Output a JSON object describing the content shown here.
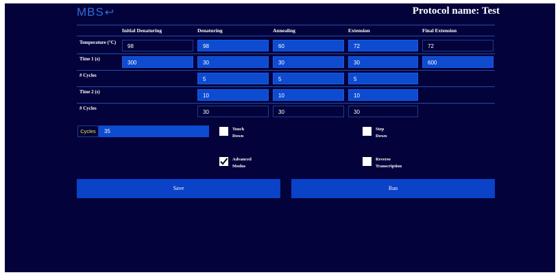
{
  "logo": {
    "text": "MBS",
    "arrow": "↩"
  },
  "header": {
    "protocol_title": "Protocol name: Test"
  },
  "columns": [
    "Initial Denaturing",
    "Denaturing",
    "Annealing",
    "Extension",
    "Final Extension"
  ],
  "rows": [
    {
      "label": "Temperature (°C)",
      "values": [
        "98",
        "98",
        "60",
        "72",
        "72"
      ]
    },
    {
      "label": "Time 1 (s)",
      "values": [
        "300",
        "30",
        "30",
        "30",
        "600"
      ]
    },
    {
      "label": "# Cycles",
      "values": [
        "",
        "5",
        "5",
        "5",
        ""
      ]
    },
    {
      "label": "Time 2 (s)",
      "values": [
        "",
        "10",
        "10",
        "10",
        ""
      ]
    },
    {
      "label": "# Cycles",
      "values": [
        "",
        "30",
        "30",
        "30",
        ""
      ]
    }
  ],
  "cycles": {
    "label": "Cycles",
    "value": "35"
  },
  "options": {
    "touch_down": {
      "label_line1": "Touch",
      "label_line2": "Down",
      "checked": false
    },
    "step_down": {
      "label_line1": "Step",
      "label_line2": "Down",
      "checked": false
    },
    "advanced_modus": {
      "label_line1": "Advanced",
      "label_line2": "Modus",
      "checked": true
    },
    "reverse_transcription": {
      "label_line1": "Reverse",
      "label_line2": "Transcription",
      "checked": false
    }
  },
  "buttons": {
    "save": "Save",
    "run": "Run"
  },
  "colors": {
    "background": "#03023a",
    "accent": "#0d4bd0",
    "logo": "#2e6fdc",
    "cycles_label": "#e8e84a"
  }
}
